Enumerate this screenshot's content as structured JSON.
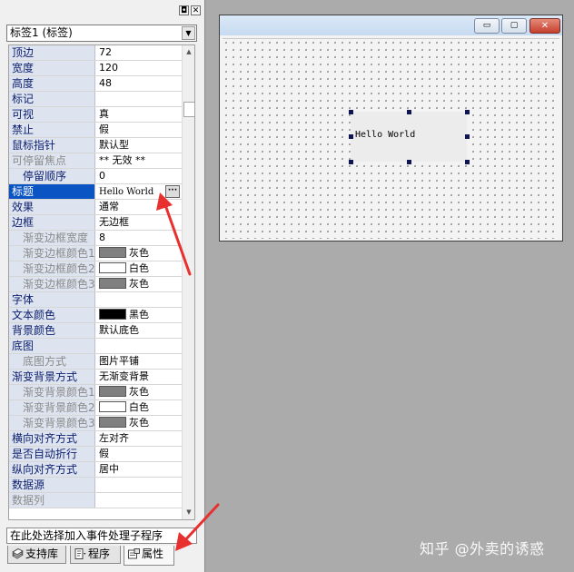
{
  "panel": {
    "pin_icon": "pin-icon",
    "close_icon": "close-icon",
    "pin_glyph": "◘",
    "close_glyph": "✕"
  },
  "object_select": {
    "value": "标签1 (标签)"
  },
  "properties": [
    {
      "name": "顶边",
      "value": "72",
      "style": "normal"
    },
    {
      "name": "宽度",
      "value": "120",
      "style": "normal"
    },
    {
      "name": "高度",
      "value": "48",
      "style": "normal"
    },
    {
      "name": "标记",
      "value": "",
      "style": "normal"
    },
    {
      "name": "可视",
      "value": "真",
      "style": "normal"
    },
    {
      "name": "禁止",
      "value": "假",
      "style": "normal"
    },
    {
      "name": "鼠标指针",
      "value": "默认型",
      "style": "normal"
    },
    {
      "name": "可停留焦点",
      "value": "** 无效 **",
      "style": "gray"
    },
    {
      "name": "停留顺序",
      "value": "0",
      "style": "indent"
    },
    {
      "name": "标题",
      "value": "Hello World",
      "style": "selected"
    },
    {
      "name": "效果",
      "value": "通常",
      "style": "normal"
    },
    {
      "name": "边框",
      "value": "无边框",
      "style": "normal"
    },
    {
      "name": "渐变边框宽度",
      "value": "8",
      "style": "indent-gray"
    },
    {
      "name": "渐变边框颜色1",
      "value": "灰色",
      "style": "indent-gray",
      "swatch": "#808080"
    },
    {
      "name": "渐变边框颜色2",
      "value": "白色",
      "style": "indent-gray",
      "swatch": "#ffffff"
    },
    {
      "name": "渐变边框颜色3",
      "value": "灰色",
      "style": "indent-gray",
      "swatch": "#808080"
    },
    {
      "name": "字体",
      "value": "",
      "style": "normal"
    },
    {
      "name": "文本颜色",
      "value": "黑色",
      "style": "normal",
      "swatch": "#000000"
    },
    {
      "name": "背景颜色",
      "value": "默认底色",
      "style": "normal"
    },
    {
      "name": "底图",
      "value": "",
      "style": "normal"
    },
    {
      "name": "底图方式",
      "value": "图片平铺",
      "style": "indent-gray"
    },
    {
      "name": "渐变背景方式",
      "value": "无渐变背景",
      "style": "normal"
    },
    {
      "name": "渐变背景颜色1",
      "value": "灰色",
      "style": "indent-gray",
      "swatch": "#808080"
    },
    {
      "name": "渐变背景颜色2",
      "value": "白色",
      "style": "indent-gray",
      "swatch": "#ffffff"
    },
    {
      "name": "渐变背景颜色3",
      "value": "灰色",
      "style": "indent-gray",
      "swatch": "#808080"
    },
    {
      "name": "横向对齐方式",
      "value": "左对齐",
      "style": "normal"
    },
    {
      "name": "是否自动折行",
      "value": "假",
      "style": "normal"
    },
    {
      "name": "纵向对齐方式",
      "value": "居中",
      "style": "normal"
    },
    {
      "name": "数据源",
      "value": "",
      "style": "normal"
    },
    {
      "name": "数据列",
      "value": "",
      "style": "gray"
    }
  ],
  "ellipsis_label": "···",
  "hint": "在此处选择加入事件处理子程序",
  "tabs": [
    {
      "label": "支持库",
      "icon": "library-icon",
      "active": false
    },
    {
      "label": "程序",
      "icon": "program-icon",
      "active": false
    },
    {
      "label": "属性",
      "icon": "properties-icon",
      "active": true
    }
  ],
  "form_window": {
    "min_glyph": "▭",
    "max_glyph": "▢",
    "close_glyph": "✕"
  },
  "label_control": {
    "text": "Hello World"
  },
  "watermark": "知乎 @外卖的诱惑",
  "colors": {
    "selection": "#0a54c4",
    "property_name_bg": "#dde4ef",
    "property_name_text": "#0d1f6e",
    "annotation_arrow": "#e8302e",
    "designer_bg": "#ababab"
  }
}
